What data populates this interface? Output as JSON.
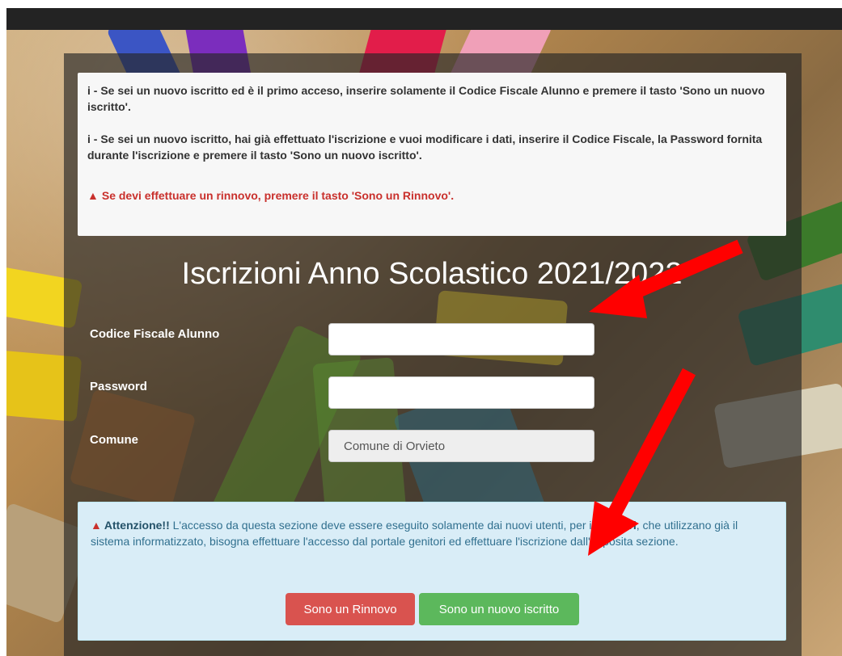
{
  "notice": {
    "line1_icon": "info-i-icon",
    "line1": "i - Se sei un nuovo iscritto ed è il primo acceso, inserire solamente il Codice Fiscale Alunno e premere il tasto 'Sono un nuovo iscritto'.",
    "line2": "i - Se sei un nuovo iscritto, hai già effettuato l'iscrizione e vuoi modificare i dati, inserire il Codice Fiscale, la Password fornita durante l'iscrizione e premere il tasto 'Sono un nuovo iscritto'.",
    "warning": "Se devi effettuare un rinnovo, premere il tasto 'Sono un Rinnovo'.",
    "warning_icon": "warning-triangle-icon",
    "warning_color": "#c9302c"
  },
  "title": "Iscrizioni Anno Scolastico 2021/2022",
  "form": {
    "codice_label": "Codice Fiscale Alunno",
    "codice_value": "",
    "password_label": "Password",
    "password_value": "",
    "comune_label": "Comune",
    "comune_value": "Comune di Orvieto"
  },
  "alert": {
    "icon": "warning-triangle-icon",
    "attention": "Attenzione!!",
    "text_before": " L'accesso da questa sezione deve essere eseguito solamente dai nuovi utenti, per i ",
    "rinnovi": "Rinnovi",
    "text_after": ", che utilizzano già il sistema informatizzato, bisogna effettuare l'accesso dal portale genitori ed effettuare l'iscrizione dall'apposita sezione."
  },
  "buttons": {
    "rinnovo": "Sono un Rinnovo",
    "nuovo": "Sono un nuovo iscritto"
  },
  "colors": {
    "red_button": "#d9534f",
    "green_button": "#5cb85c",
    "annotation_arrow": "#ff0000"
  }
}
